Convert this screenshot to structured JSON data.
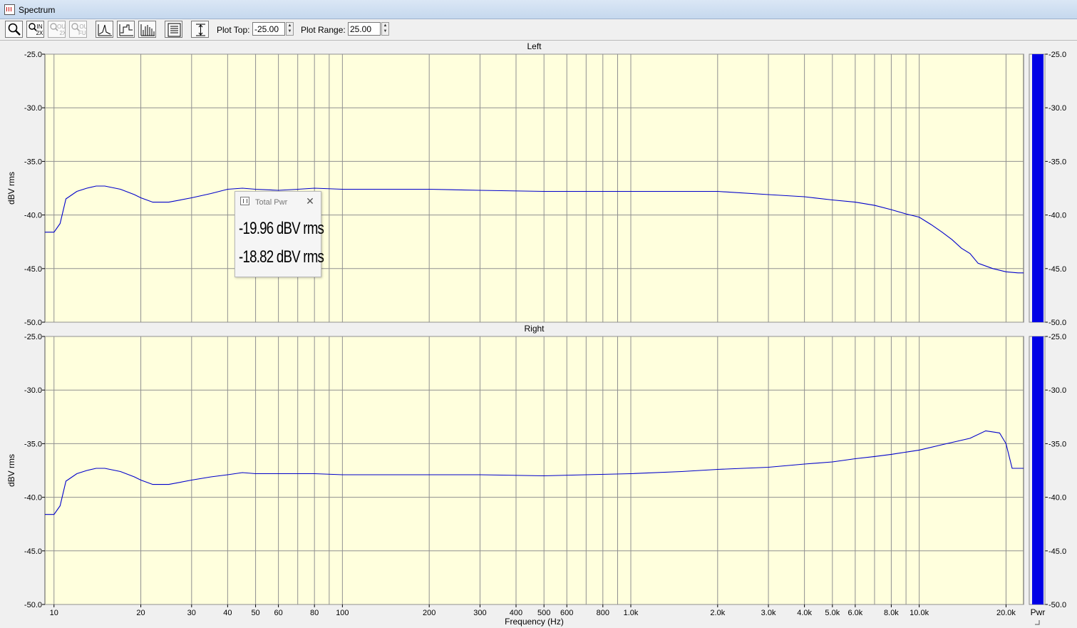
{
  "window": {
    "title": "Spectrum"
  },
  "toolbar": {
    "buttons": [
      {
        "name": "zoom-button",
        "icon": "magnifier-icon",
        "label": "",
        "enabled": true
      },
      {
        "name": "zoom-in-2x-button",
        "icon": "zoom-in-icon",
        "label": "IN 2X",
        "enabled": true
      },
      {
        "name": "zoom-out-2x-button",
        "icon": "zoom-out-icon",
        "label": "OUT 2X",
        "enabled": false
      },
      {
        "name": "zoom-out-full-button",
        "icon": "zoom-full-icon",
        "label": "OUT FULL",
        "enabled": false
      },
      {
        "name": "line-plot-button",
        "icon": "line-plot-icon",
        "label": "",
        "enabled": true
      },
      {
        "name": "step-plot-button",
        "icon": "step-plot-icon",
        "label": "",
        "enabled": true
      },
      {
        "name": "bar-plot-button",
        "icon": "bar-plot-icon",
        "label": "",
        "enabled": true
      },
      {
        "name": "display-options-button",
        "icon": "list-icon",
        "label": "",
        "enabled": true
      },
      {
        "name": "autoscale-button",
        "icon": "vertical-range-icon",
        "label": "",
        "enabled": true
      }
    ],
    "plot_top_label": "Plot Top:",
    "plot_top_value": "-25.00",
    "plot_range_label": "Plot Range:",
    "plot_range_value": "25.00"
  },
  "popup": {
    "title": "Total Pwr",
    "values": [
      "-19.96 dBV rms",
      "-18.82 dBV rms"
    ]
  },
  "colors": {
    "plot_background": "#ffffdd",
    "trace": "#0000cc",
    "meter": "#0000e6",
    "grid": "#909090"
  },
  "chart_data": [
    {
      "type": "line",
      "title": "Left",
      "xlabel": "Frequency (Hz)",
      "ylabel": "dBV rms",
      "x_scale": "log",
      "xlim": [
        9.3,
        23000
      ],
      "ylim": [
        -50,
        -25
      ],
      "yticks": [
        "-25.0",
        "-30.0",
        "-35.0",
        "-40.0",
        "-45.0",
        "-50.0"
      ],
      "xtick_labels": [
        "10",
        "20",
        "30",
        "40",
        "50",
        "60",
        "80",
        "100",
        "200",
        "300",
        "400",
        "500",
        "600",
        "800",
        "1.0k",
        "2.0k",
        "3.0k",
        "4.0k",
        "5.0k",
        "6.0k",
        "8.0k",
        "10.0k",
        "20.0k"
      ],
      "grid": true,
      "x": [
        9.3,
        10,
        10.5,
        11,
        12,
        13,
        14,
        15,
        17,
        19,
        20,
        22,
        25,
        30,
        35,
        40,
        45,
        50,
        60,
        70,
        80,
        100,
        150,
        200,
        300,
        500,
        700,
        1000,
        1500,
        2000,
        3000,
        4000,
        5000,
        6000,
        7000,
        8000,
        9000,
        10000,
        11000,
        12000,
        13000,
        14000,
        15000,
        16000,
        18000,
        20000,
        22000,
        23000
      ],
      "y": [
        -41.6,
        -41.6,
        -40.8,
        -38.5,
        -37.8,
        -37.5,
        -37.3,
        -37.3,
        -37.6,
        -38.1,
        -38.4,
        -38.8,
        -38.8,
        -38.4,
        -38.0,
        -37.6,
        -37.5,
        -37.6,
        -37.7,
        -37.6,
        -37.5,
        -37.6,
        -37.6,
        -37.6,
        -37.7,
        -37.8,
        -37.8,
        -37.8,
        -37.8,
        -37.8,
        -38.1,
        -38.3,
        -38.6,
        -38.8,
        -39.1,
        -39.5,
        -39.9,
        -40.2,
        -40.9,
        -41.6,
        -42.3,
        -43.1,
        -43.6,
        -44.5,
        -45.0,
        -45.3,
        -45.4,
        -45.4
      ],
      "meter_value": -25.0
    },
    {
      "type": "line",
      "title": "Right",
      "xlabel": "Frequency (Hz)",
      "ylabel": "dBV rms",
      "x_scale": "log",
      "xlim": [
        9.3,
        23000
      ],
      "ylim": [
        -50,
        -25
      ],
      "yticks": [
        "-25.0",
        "-30.0",
        "-35.0",
        "-40.0",
        "-45.0",
        "-50.0"
      ],
      "xtick_labels": [
        "10",
        "20",
        "30",
        "40",
        "50",
        "60",
        "80",
        "100",
        "200",
        "300",
        "400",
        "500",
        "600",
        "800",
        "1.0k",
        "2.0k",
        "3.0k",
        "4.0k",
        "5.0k",
        "6.0k",
        "8.0k",
        "10.0k",
        "20.0k"
      ],
      "x_axis_title": "Frequency (Hz)",
      "meter_label": "Pwr",
      "grid": true,
      "x": [
        9.3,
        10,
        10.5,
        11,
        12,
        13,
        14,
        15,
        17,
        19,
        20,
        22,
        25,
        30,
        35,
        40,
        45,
        50,
        60,
        70,
        80,
        100,
        200,
        300,
        500,
        700,
        1000,
        1500,
        2000,
        3000,
        4000,
        5000,
        6000,
        7000,
        8000,
        10000,
        12000,
        15000,
        17000,
        18000,
        19000,
        20000,
        21000,
        22000,
        23000
      ],
      "y": [
        -41.6,
        -41.6,
        -40.8,
        -38.5,
        -37.8,
        -37.5,
        -37.3,
        -37.3,
        -37.6,
        -38.1,
        -38.4,
        -38.8,
        -38.8,
        -38.4,
        -38.1,
        -37.9,
        -37.7,
        -37.8,
        -37.8,
        -37.8,
        -37.8,
        -37.9,
        -37.9,
        -37.9,
        -38.0,
        -37.9,
        -37.8,
        -37.6,
        -37.4,
        -37.2,
        -36.9,
        -36.7,
        -36.4,
        -36.2,
        -36.0,
        -35.6,
        -35.1,
        -34.5,
        -33.8,
        -33.9,
        -34.0,
        -35.0,
        -37.3,
        -37.3,
        -37.3
      ],
      "meter_value": -25.0
    }
  ]
}
